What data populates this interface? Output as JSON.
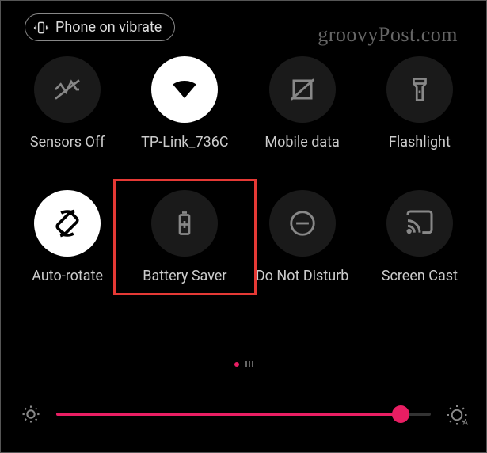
{
  "status_pill": {
    "label": "Phone on vibrate"
  },
  "watermark": "groovyPost.com",
  "tiles": {
    "sensors_off": {
      "label": "Sensors Off"
    },
    "wifi": {
      "label": "TP-Link_736C"
    },
    "mobile_data": {
      "label": "Mobile data"
    },
    "flashlight": {
      "label": "Flashlight"
    },
    "auto_rotate": {
      "label": "Auto-rotate"
    },
    "battery_saver": {
      "label": "Battery Saver"
    },
    "dnd": {
      "label": "Do Not Disturb"
    },
    "screen_cast": {
      "label": "Screen Cast"
    }
  },
  "brightness": {
    "value_pct": 92
  },
  "highlighted_tile": "battery_saver",
  "accent_color": "#e91e63"
}
